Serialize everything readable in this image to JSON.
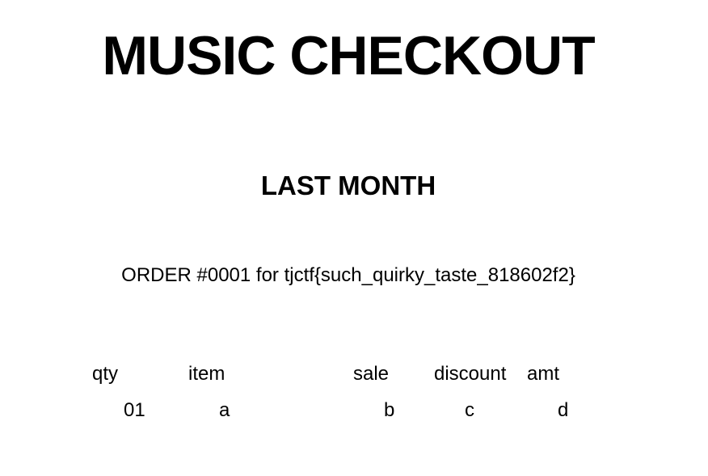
{
  "header": {
    "title": "MUSIC CHECKOUT",
    "subtitle": "LAST MONTH"
  },
  "order": {
    "line": "ORDER #0001 for tjctf{such_quirky_taste_818602f2}"
  },
  "table": {
    "columns": [
      "qty",
      "item",
      "sale",
      "discount",
      "amt"
    ],
    "rows": [
      [
        "01",
        "a",
        "b",
        "c",
        "d"
      ]
    ]
  }
}
